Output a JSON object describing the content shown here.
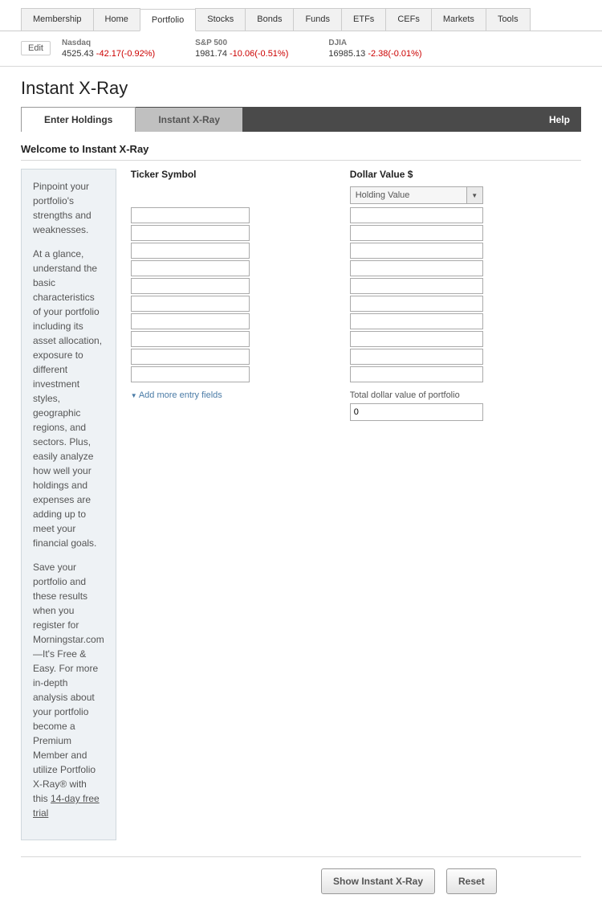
{
  "nav": {
    "tabs": [
      "Membership",
      "Home",
      "Portfolio",
      "Stocks",
      "Bonds",
      "Funds",
      "ETFs",
      "CEFs",
      "Markets",
      "Tools"
    ],
    "active_index": 2
  },
  "ticker_bar": {
    "edit_label": "Edit",
    "items": [
      {
        "name": "Nasdaq",
        "value": "4525.43",
        "change": "-42.17(-0.92%)"
      },
      {
        "name": "S&P 500",
        "value": "1981.74",
        "change": "-10.06(-0.51%)"
      },
      {
        "name": "DJIA",
        "value": "16985.13",
        "change": "-2.38(-0.01%)"
      }
    ]
  },
  "page_title": "Instant X-Ray",
  "section_tabs": {
    "enter_holdings": "Enter Holdings",
    "instant_xray": "Instant X-Ray",
    "help": "Help"
  },
  "welcome": {
    "header": "Welcome to Instant X-Ray",
    "p1": "Pinpoint your portfolio's strengths and weaknesses.",
    "p2": "At a glance, understand the basic characteristics of your portfolio including its asset allocation, exposure to different investment styles, geographic regions, and sectors. Plus, easily analyze how well your holdings and expenses are adding up to meet your financial goals.",
    "p3a": "Save your portfolio and these results when you register for Morningstar.com—It's Free & Easy. For more in-depth analysis about your portfolio become a Premium Member and utilize Portfolio X-Ray® with this ",
    "p3_link": "14-day free trial"
  },
  "entry": {
    "ticker_header": "Ticker Symbol",
    "dollar_header": "Dollar Value $",
    "holding_select": "Holding Value",
    "add_more": "Add more entry fields",
    "total_label": "Total dollar value of portfolio",
    "total_value": "0",
    "row_count": 10
  },
  "buttons": {
    "show": "Show Instant X-Ray",
    "reset": "Reset"
  }
}
